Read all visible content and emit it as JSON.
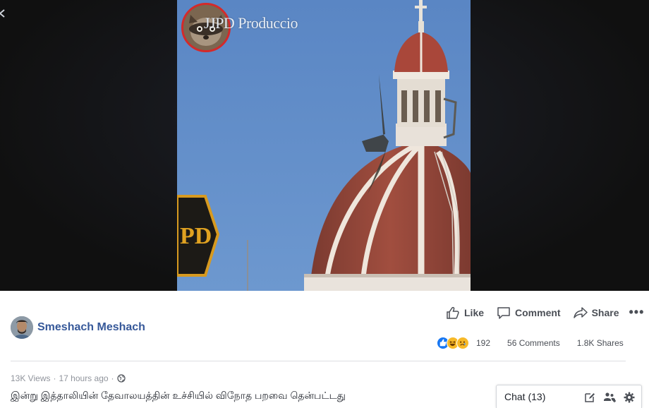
{
  "video": {
    "watermark": "JJPD Produccio",
    "close_glyph": "<"
  },
  "post": {
    "author_name": "Smeshach Meshach",
    "views": "13K Views",
    "time": "17 hours ago",
    "separator": "·",
    "caption": "இன்று இத்தாலியின் தேவாலயத்தின் உச்சியில் விநோத பறவை தென்பட்டது"
  },
  "actions": {
    "like": "Like",
    "comment": "Comment",
    "share": "Share",
    "more": "•••"
  },
  "stats": {
    "reaction_count": "192",
    "comments": "56 Comments",
    "shares": "1.8K Shares"
  },
  "chat": {
    "label": "Chat (13)"
  },
  "colors": {
    "link_blue": "#365899",
    "like_blue": "#1877f2",
    "haha_yellow": "#f7b928",
    "text_gray": "#4b4f56",
    "meta_gray": "#90949c"
  },
  "icons": [
    "close-icon",
    "like-icon",
    "comment-icon",
    "share-icon",
    "more-icon",
    "globe-icon",
    "compose-icon",
    "group-icon",
    "gear-icon"
  ]
}
